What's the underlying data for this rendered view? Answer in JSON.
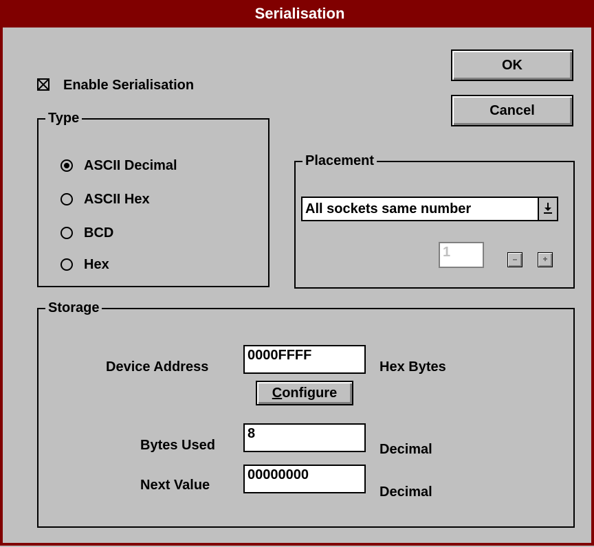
{
  "window": {
    "title": "Serialisation"
  },
  "buttons": {
    "ok": "OK",
    "cancel": "Cancel",
    "configure_prefix": "C",
    "configure_rest": "onfigure"
  },
  "enable": {
    "label": "Enable Serialisation",
    "checked": true
  },
  "type_group": {
    "legend": "Type",
    "options": [
      {
        "label": "ASCII Decimal",
        "selected": true
      },
      {
        "label": "ASCII Hex",
        "selected": false
      },
      {
        "label": "BCD",
        "selected": false
      },
      {
        "label": "Hex",
        "selected": false
      }
    ]
  },
  "placement": {
    "legend": "Placement",
    "selected": "All sockets same number",
    "spinner_value": "1",
    "dec_icon": "minus-icon",
    "inc_icon": "plus-icon"
  },
  "storage": {
    "legend": "Storage",
    "device_address_label": "Device Address",
    "device_address_value": "0000FFFF",
    "device_address_unit": "Hex Bytes",
    "bytes_used_label": "Bytes Used",
    "bytes_used_value": "8",
    "bytes_used_unit": "Decimal",
    "next_value_label": "Next Value",
    "next_value_value": "00000000",
    "next_value_unit": "Decimal"
  }
}
